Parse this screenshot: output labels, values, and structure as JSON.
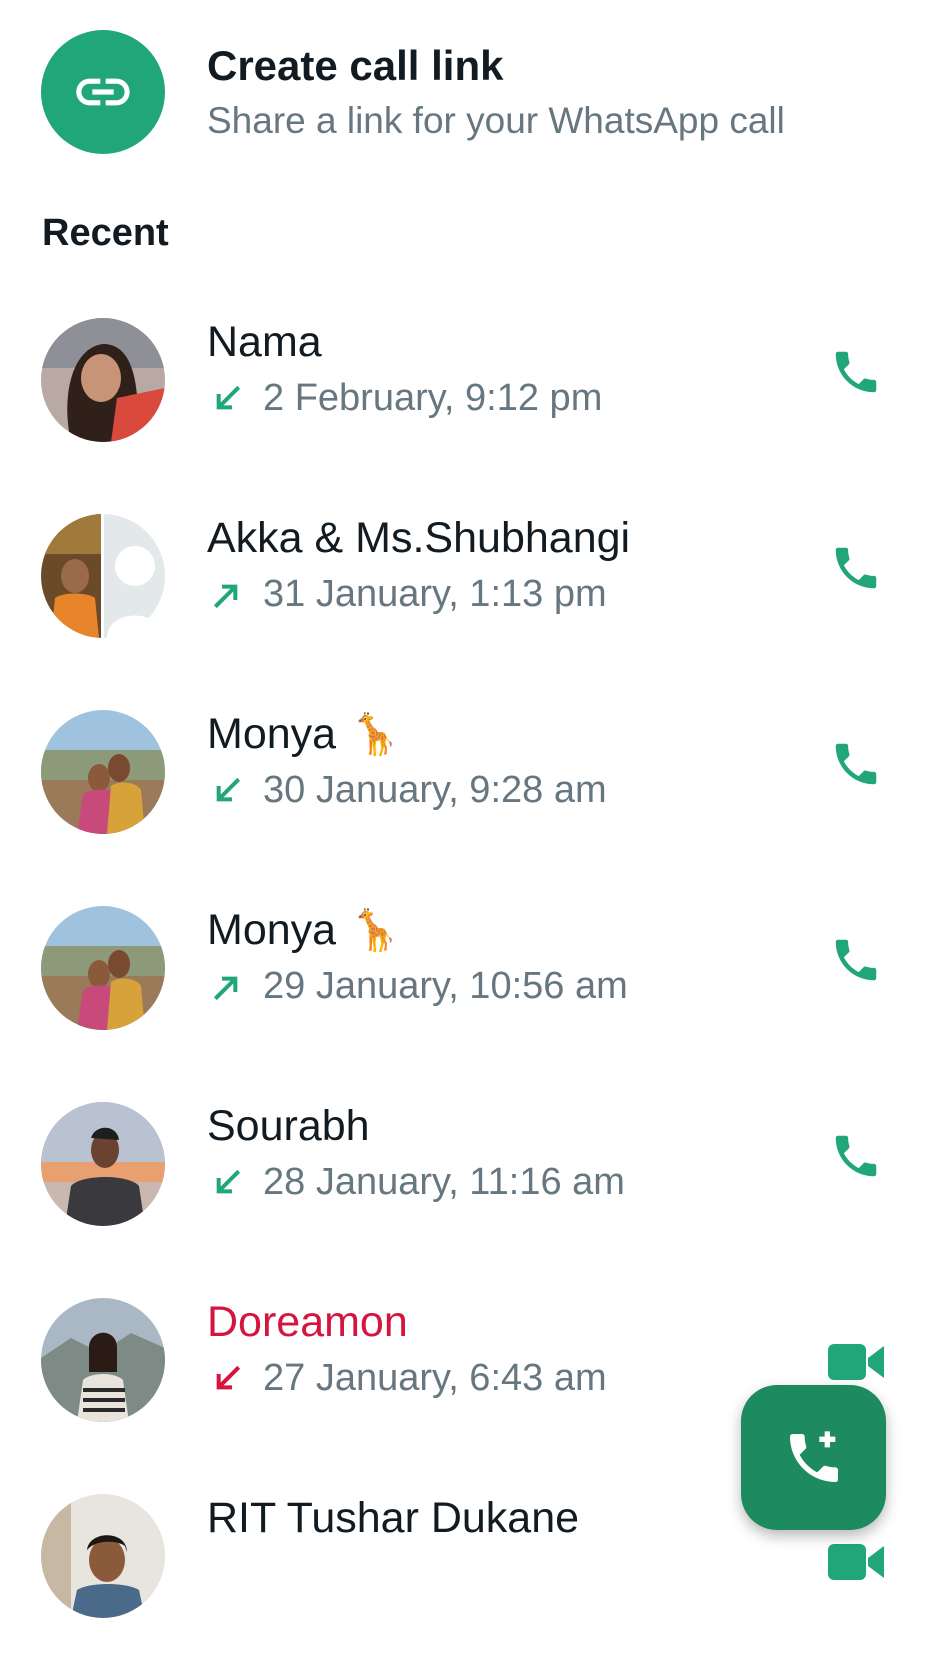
{
  "create_link": {
    "title": "Create call link",
    "subtitle": "Share a link for your WhatsApp call",
    "icon": "link-icon"
  },
  "section_title": "Recent",
  "calls": [
    {
      "name": "Nama",
      "emoji": "",
      "direction": "incoming",
      "missed": false,
      "time": "2 February, 9:12 pm",
      "type": "voice"
    },
    {
      "name": "Akka & Ms.Shubhangi",
      "emoji": "",
      "direction": "outgoing",
      "missed": false,
      "time": "31 January, 1:13 pm",
      "type": "voice"
    },
    {
      "name": "Monya",
      "emoji": "🦒",
      "direction": "incoming",
      "missed": false,
      "time": "30 January, 9:28 am",
      "type": "voice"
    },
    {
      "name": "Monya",
      "emoji": "🦒",
      "direction": "outgoing",
      "missed": false,
      "time": "29 January, 10:56 am",
      "type": "voice"
    },
    {
      "name": "Sourabh",
      "emoji": "",
      "direction": "incoming",
      "missed": false,
      "time": "28 January, 11:16 am",
      "type": "voice"
    },
    {
      "name": "Doreamon",
      "emoji": "",
      "direction": "incoming",
      "missed": true,
      "time": "27 January, 6:43 am",
      "type": "video"
    },
    {
      "name": "RIT Tushar Dukane",
      "emoji": "",
      "direction": "incoming",
      "missed": false,
      "time": "",
      "type": "video"
    }
  ],
  "fab": {
    "icon": "new-call-icon"
  },
  "colors": {
    "accent": "#21a67a",
    "fab": "#1d8a5f",
    "missed": "#d5143f",
    "secondary_text": "#667781",
    "primary_text": "#111b21"
  }
}
